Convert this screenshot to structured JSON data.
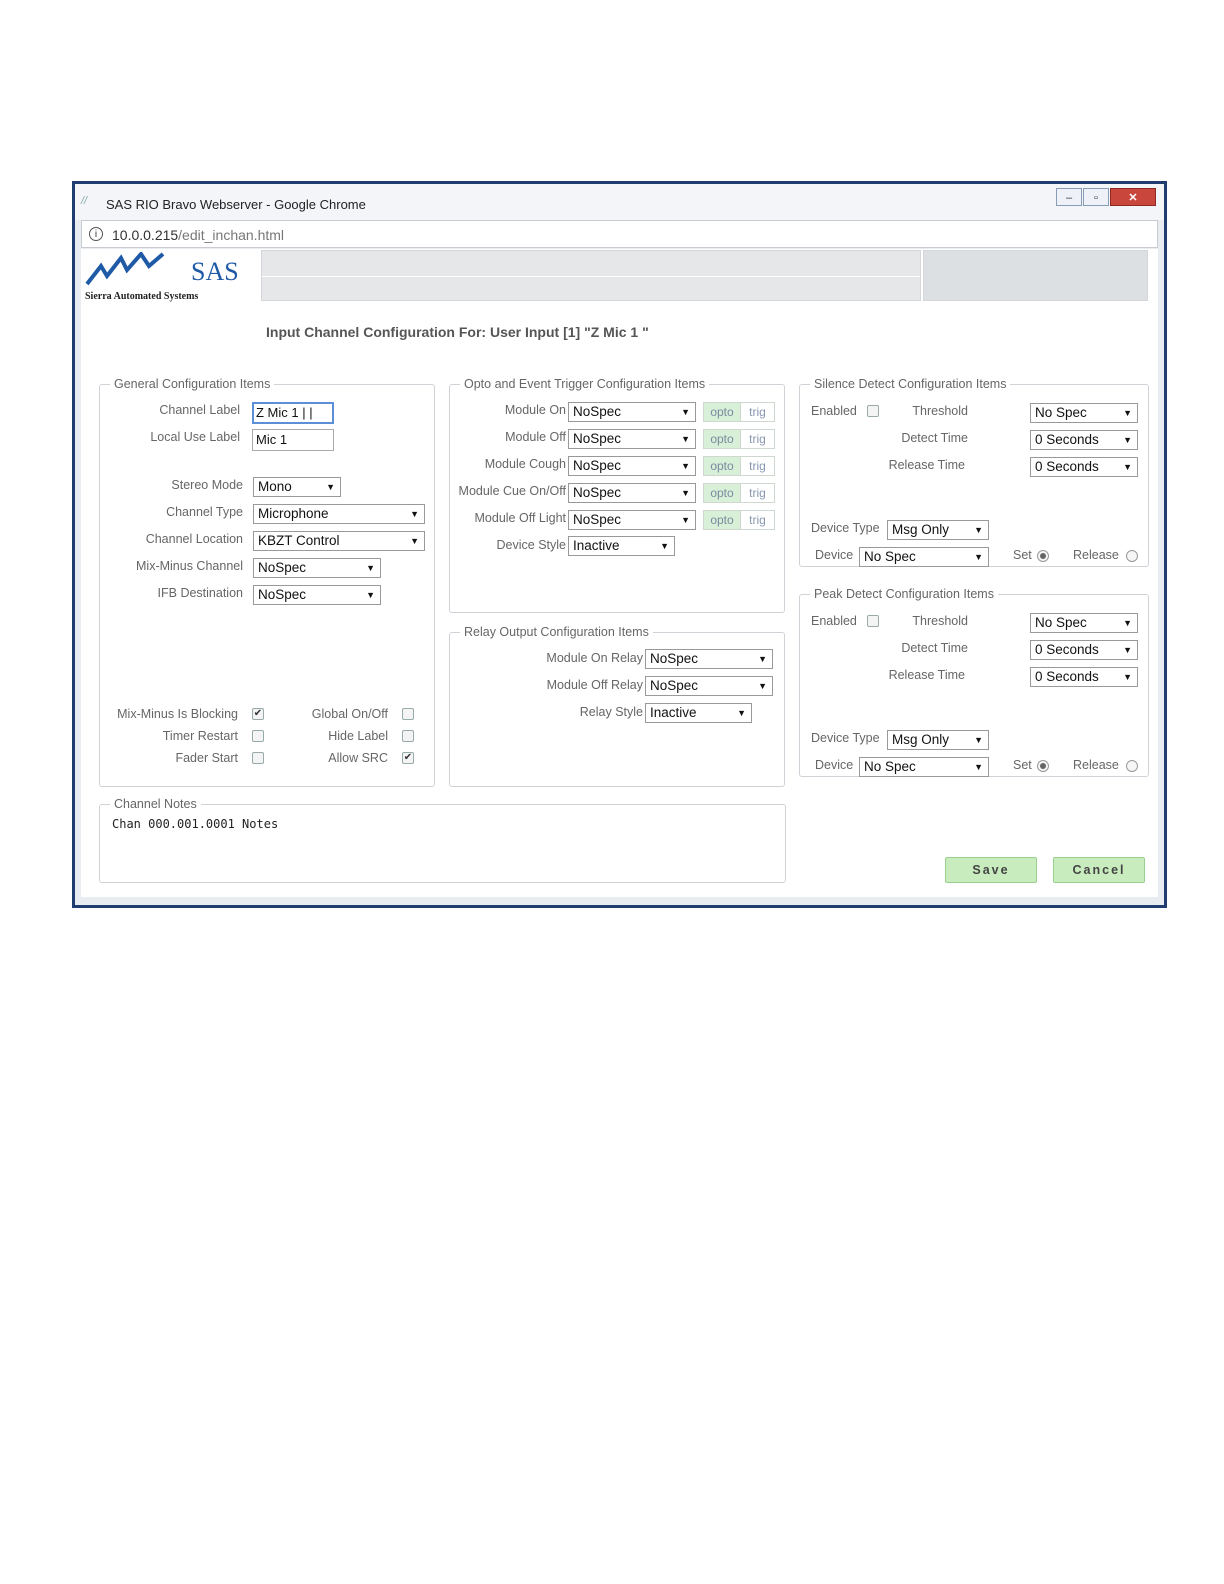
{
  "window": {
    "title": "SAS RIO Bravo Webserver - Google Chrome",
    "url_host": "10.0.0.215",
    "url_path": "/edit_inchan.html"
  },
  "logo": {
    "brand": "SAS",
    "subtitle": "Sierra Automated Systems"
  },
  "heading": "Input Channel Configuration For: User Input [1] \"Z Mic 1 \"",
  "general": {
    "legend": "General Configuration Items",
    "channel_label": "Channel Label",
    "channel_label_value": "Z Mic 1",
    "local_use_label": "Local Use Label",
    "local_use_value": "Mic 1",
    "stereo_mode": "Stereo Mode",
    "stereo_mode_value": "Mono",
    "channel_type": "Channel Type",
    "channel_type_value": "Microphone",
    "channel_location": "Channel Location",
    "channel_location_value": "KBZT Control",
    "mix_minus_channel": "Mix-Minus Channel",
    "mix_minus_channel_value": "NoSpec",
    "ifb_destination": "IFB Destination",
    "ifb_destination_value": "NoSpec",
    "mix_minus_blocking": "Mix-Minus Is Blocking",
    "global_on_off": "Global On/Off",
    "timer_restart": "Timer Restart",
    "hide_label": "Hide Label",
    "fader_start": "Fader Start",
    "allow_src": "Allow SRC"
  },
  "opto": {
    "legend": "Opto and Event Trigger Configuration Items",
    "rows": [
      {
        "label": "Module On",
        "value": "NoSpec"
      },
      {
        "label": "Module Off",
        "value": "NoSpec"
      },
      {
        "label": "Module Cough",
        "value": "NoSpec"
      },
      {
        "label": "Module Cue On/Off",
        "value": "NoSpec"
      },
      {
        "label": "Module Off Light",
        "value": "NoSpec"
      }
    ],
    "opto_label": "opto",
    "trig_label": "trig",
    "device_style": "Device Style",
    "device_style_value": "Inactive"
  },
  "relay": {
    "legend": "Relay Output Configuration Items",
    "module_on_relay": "Module On Relay",
    "module_on_relay_value": "NoSpec",
    "module_off_relay": "Module Off Relay",
    "module_off_relay_value": "NoSpec",
    "relay_style": "Relay Style",
    "relay_style_value": "Inactive"
  },
  "silence": {
    "legend": "Silence Detect Configuration Items",
    "enabled": "Enabled",
    "threshold": "Threshold",
    "threshold_value": "No Spec",
    "detect_time": "Detect Time",
    "detect_time_value": "0 Seconds",
    "release_time": "Release Time",
    "release_time_value": "0 Seconds",
    "device_type": "Device Type",
    "device_type_value": "Msg Only",
    "device": "Device",
    "device_value": "No Spec",
    "set": "Set",
    "release": "Release"
  },
  "peak": {
    "legend": "Peak Detect Configuration Items",
    "enabled": "Enabled",
    "threshold": "Threshold",
    "threshold_value": "No Spec",
    "detect_time": "Detect Time",
    "detect_time_value": "0 Seconds",
    "release_time": "Release Time",
    "release_time_value": "0 Seconds",
    "device_type": "Device Type",
    "device_type_value": "Msg Only",
    "device": "Device",
    "device_value": "No Spec",
    "set": "Set",
    "release": "Release"
  },
  "notes": {
    "legend": "Channel Notes",
    "text": "Chan 000.001.0001 Notes"
  },
  "buttons": {
    "save": "Save",
    "cancel": "Cancel"
  },
  "checkmark": "✔",
  "arrow": "▼"
}
